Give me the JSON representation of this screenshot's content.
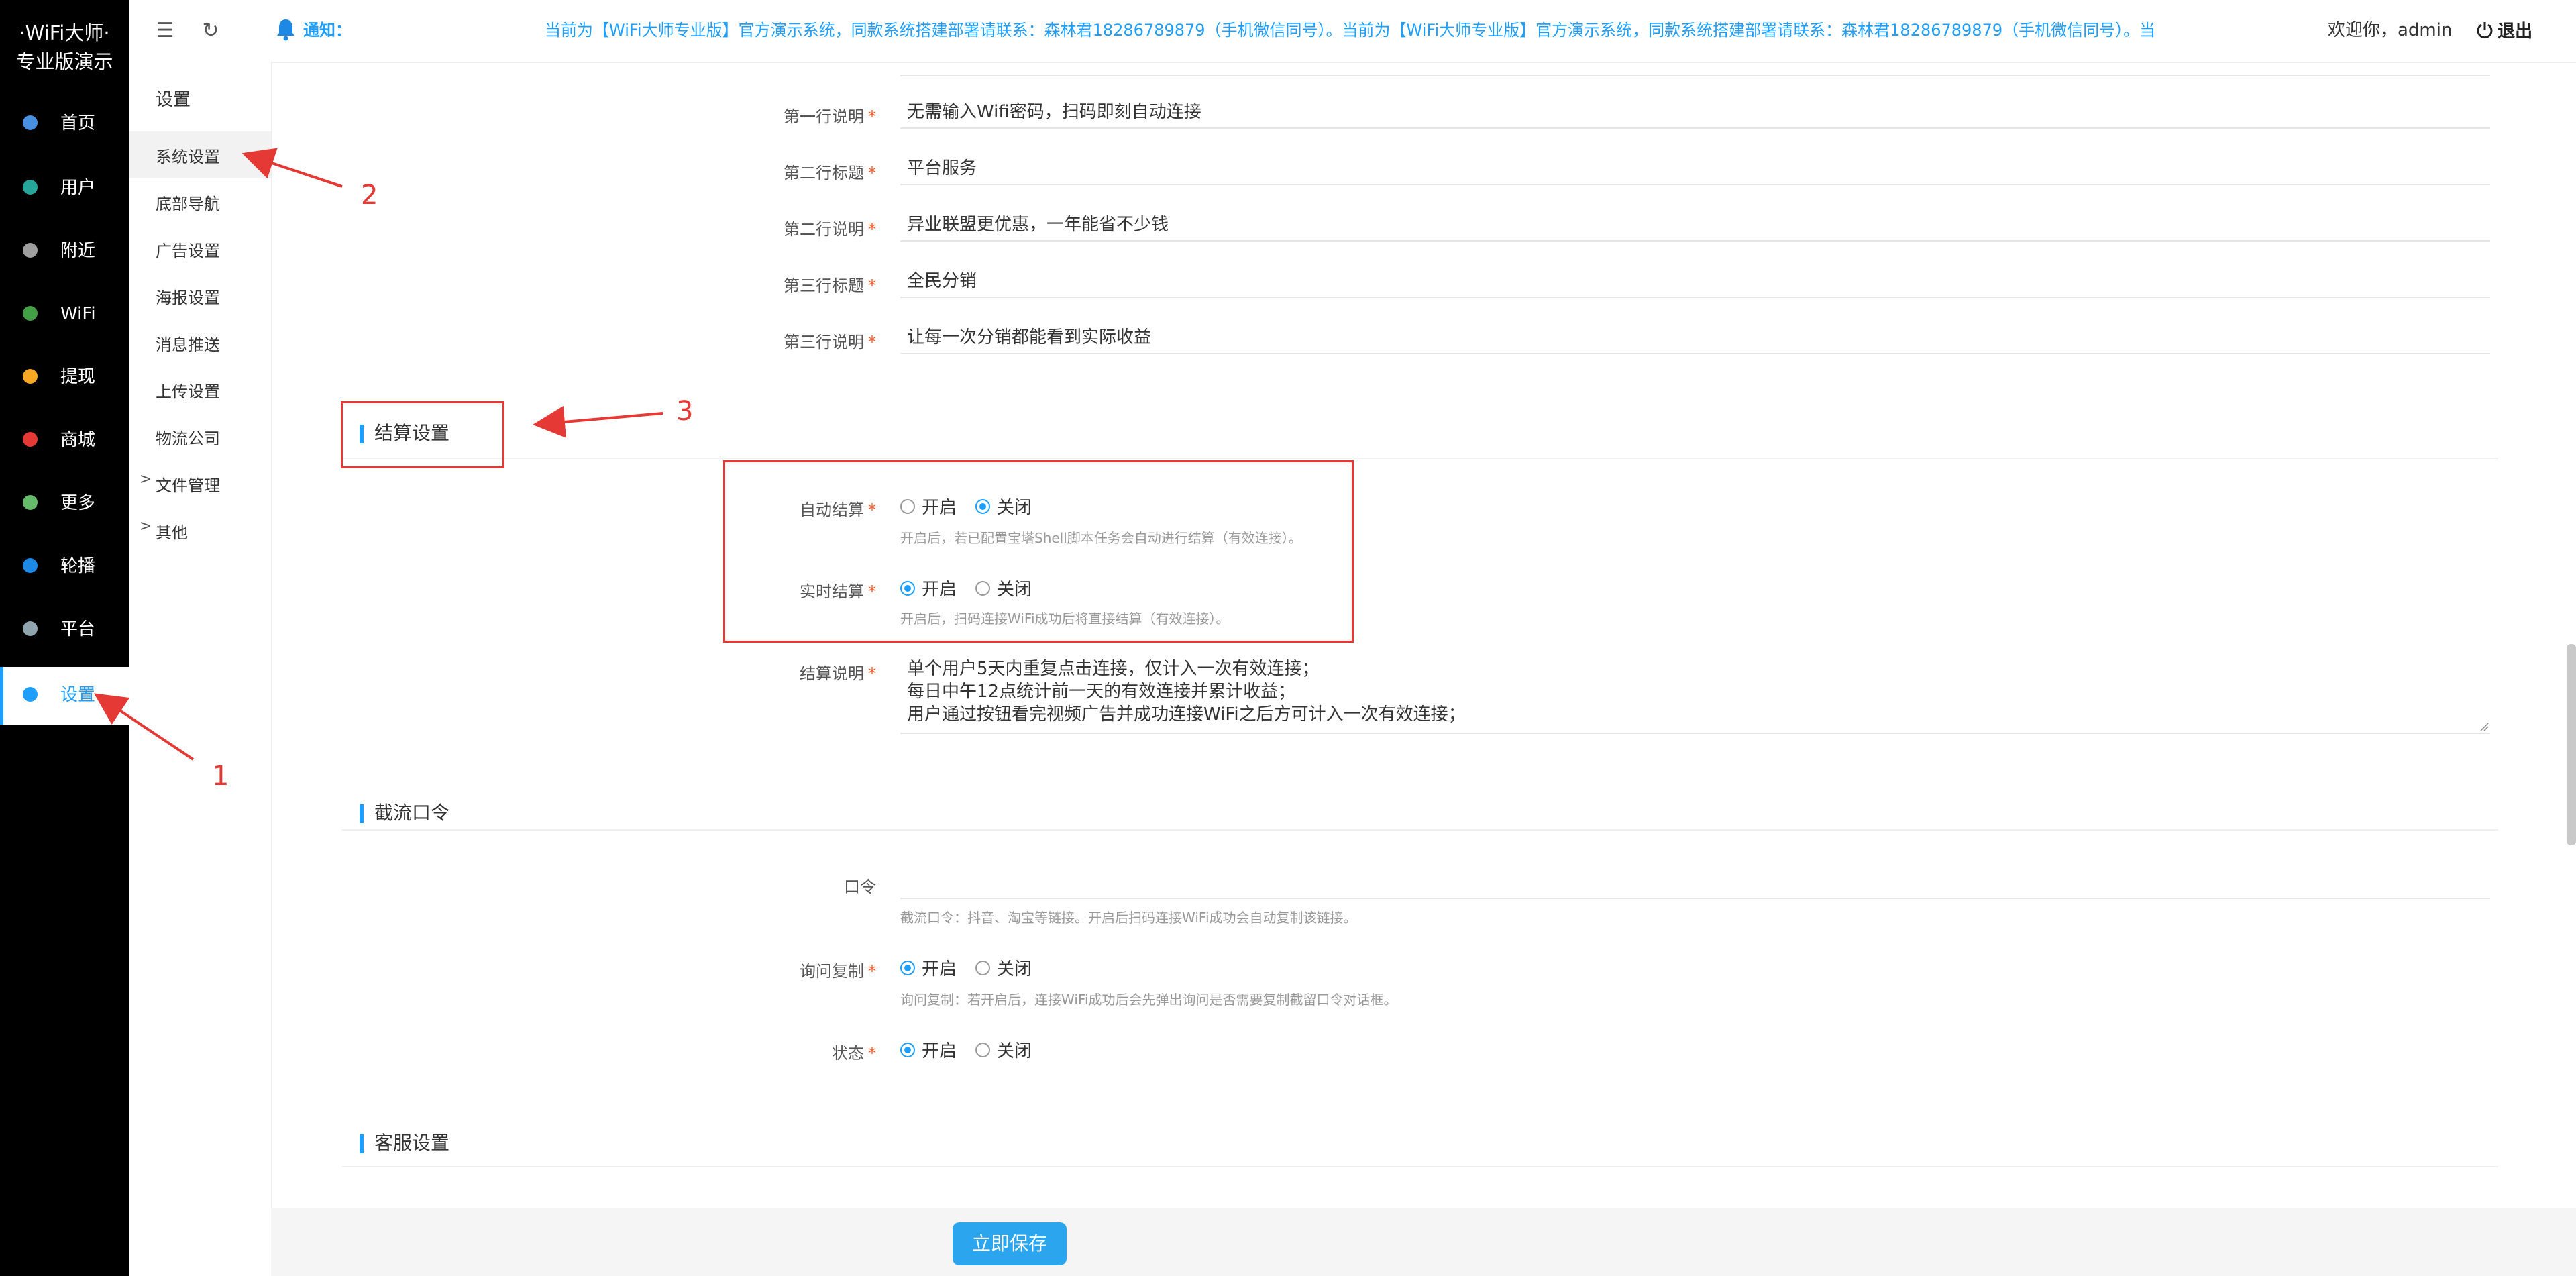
{
  "app": {
    "logo_line1": "·WiFi大师·",
    "logo_line2": "专业版演示"
  },
  "left_menu": [
    {
      "label": "首页",
      "icon": "home-icon",
      "color": "#4a90e2"
    },
    {
      "label": "用户",
      "icon": "user-icon",
      "color": "#26a69a"
    },
    {
      "label": "附近",
      "icon": "location-icon",
      "color": "#9e9e9e"
    },
    {
      "label": "WiFi",
      "icon": "wifi-icon",
      "color": "#43a047"
    },
    {
      "label": "提现",
      "icon": "coin-icon",
      "color": "#f9a825"
    },
    {
      "label": "商城",
      "icon": "shop-icon",
      "color": "#e53935"
    },
    {
      "label": "更多",
      "icon": "more-icon",
      "color": "#66bb6a"
    },
    {
      "label": "轮播",
      "icon": "carousel-icon",
      "color": "#1e88e5"
    },
    {
      "label": "平台",
      "icon": "platform-icon",
      "color": "#90a4ae"
    },
    {
      "label": "设置",
      "icon": "settings-icon",
      "color": "#1e9fff",
      "active": true
    }
  ],
  "topbar": {
    "notice_label": "通知：",
    "notice_text": "当前为【WiFi大师专业版】官方演示系统，同款系统搭建部署请联系：森林君18286789879（手机微信同号）。当前为【WiFi大师专业版】官方演示系统，同款系统搭建部署请联系：森林君18286789879（手机微信同号）。当前为【WiFi大",
    "welcome": "欢迎你，admin",
    "logout": "退出"
  },
  "subnav": {
    "title": "设置",
    "items": [
      {
        "label": "系统设置",
        "active": true
      },
      {
        "label": "底部导航"
      },
      {
        "label": "广告设置"
      },
      {
        "label": "海报设置"
      },
      {
        "label": "消息推送"
      },
      {
        "label": "上传设置"
      },
      {
        "label": "物流公司"
      },
      {
        "label": "文件管理",
        "arrow": ">"
      },
      {
        "label": "其他",
        "arrow": ">"
      }
    ]
  },
  "form": {
    "rows": [
      {
        "label": "第一行说明",
        "value": "无需输入Wifi密码，扫码即刻自动连接"
      },
      {
        "label": "第二行标题",
        "value": "平台服务"
      },
      {
        "label": "第二行说明",
        "value": "异业联盟更优惠，一年能省不少钱"
      },
      {
        "label": "第三行标题",
        "value": "全民分销"
      },
      {
        "label": "第三行说明",
        "value": "让每一次分销都能看到实际收益"
      }
    ],
    "settle_section": "结算设置",
    "auto_settle": {
      "label": "自动结算",
      "on": "开启",
      "off": "关闭",
      "hint": "开启后，若已配置宝塔Shell脚本任务会自动进行结算（有效连接）。"
    },
    "realtime_settle": {
      "label": "实时结算",
      "on": "开启",
      "off": "关闭",
      "hint": "开启后，扫码连接WiFi成功后将直接结算（有效连接）。"
    },
    "settle_desc": {
      "label": "结算说明",
      "lines": [
        "单个用户5天内重复点击连接，仅计入一次有效连接；",
        "每日中午12点统计前一天的有效连接并累计收益；",
        "用户通过按钮看完视频广告并成功连接WiFi之后方可计入一次有效连接；"
      ]
    },
    "intercept_section": "截流口令",
    "password": {
      "label": "口令",
      "value": "",
      "hint": "截流口令：抖音、淘宝等链接。开启后扫码连接WiFi成功会自动复制该链接。"
    },
    "ask_copy": {
      "label": "询问复制",
      "on": "开启",
      "off": "关闭",
      "hint": "询问复制：若开启后，连接WiFi成功后会先弹出询问是否需要复制截留口令对话框。"
    },
    "status": {
      "label": "状态",
      "on": "开启",
      "off": "关闭"
    },
    "service_section": "客服设置",
    "save": "立即保存"
  },
  "annotations": [
    "1",
    "2",
    "3"
  ],
  "colors": {
    "accent": "#1e9fff",
    "annotation": "#e53935",
    "required": "#ff5722",
    "button": "#2ba6ee"
  }
}
